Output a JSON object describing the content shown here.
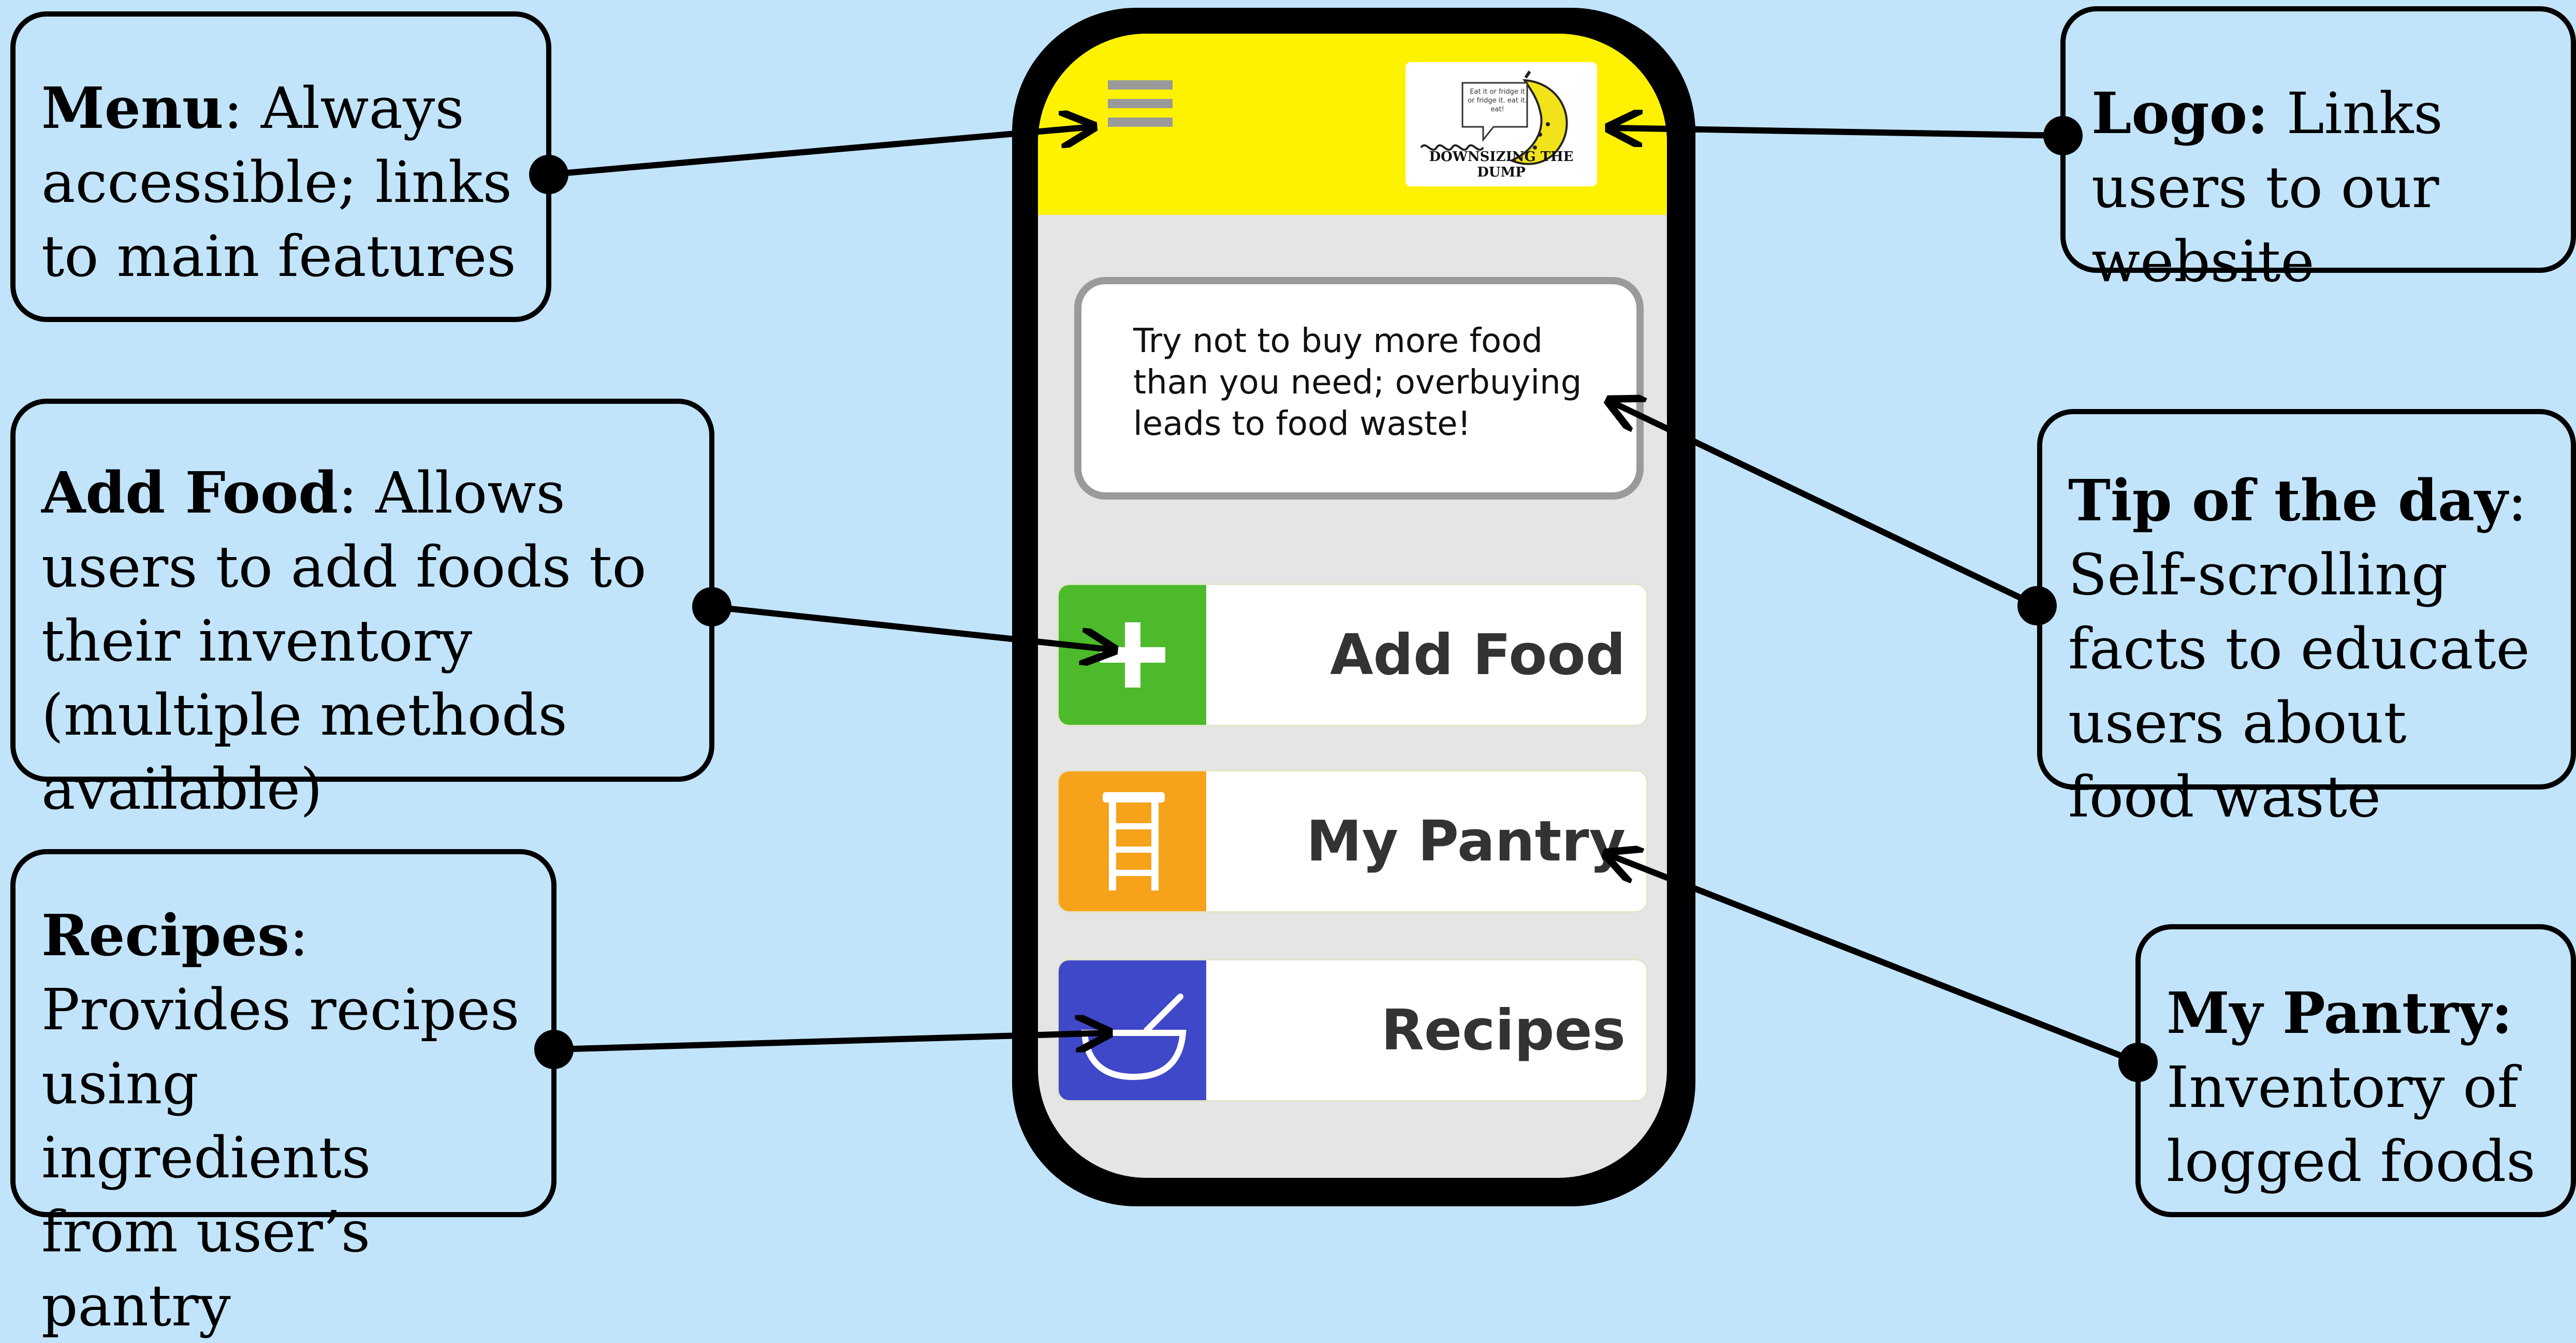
{
  "app": {
    "logo": {
      "name": "DOWNSIZING THE DUMP",
      "bubble": "Eat it or fridge it or fridge it. eat it. eat!"
    },
    "tip_of_the_day": "Try not to buy more food than you need; overbuying leads to food waste!",
    "buttons": [
      {
        "label": "Add Food",
        "color": "#4cba2a",
        "icon": "plus-icon"
      },
      {
        "label": "My Pantry",
        "color": "#f6a21a",
        "icon": "shelf-icon"
      },
      {
        "label": "Recipes",
        "color": "#3f48c8",
        "icon": "bowl-icon"
      }
    ],
    "topbar_color": "#fff200",
    "menu_icon": "hamburger-menu-icon"
  },
  "annotations": {
    "menu": {
      "title": "Menu",
      "sep": ":",
      "text": " Always accessible; links to main features"
    },
    "add_food": {
      "title": "Add Food",
      "sep": ":",
      "text": " Allows users to add foods to their inventory (multiple methods available)"
    },
    "recipes": {
      "title": "Recipes",
      "sep": ":",
      "text": " Provides recipes using ingredients from user’s pantry"
    },
    "logo": {
      "title": "Logo:",
      "sep": "",
      "text": " Links users to our website"
    },
    "tip": {
      "title": "Tip of the day",
      "sep": ":",
      "text": " Self-scrolling facts to educate users about food waste"
    },
    "pantry": {
      "title": "My Pantry:",
      "sep": "",
      "text": " Inventory of logged foods"
    }
  }
}
